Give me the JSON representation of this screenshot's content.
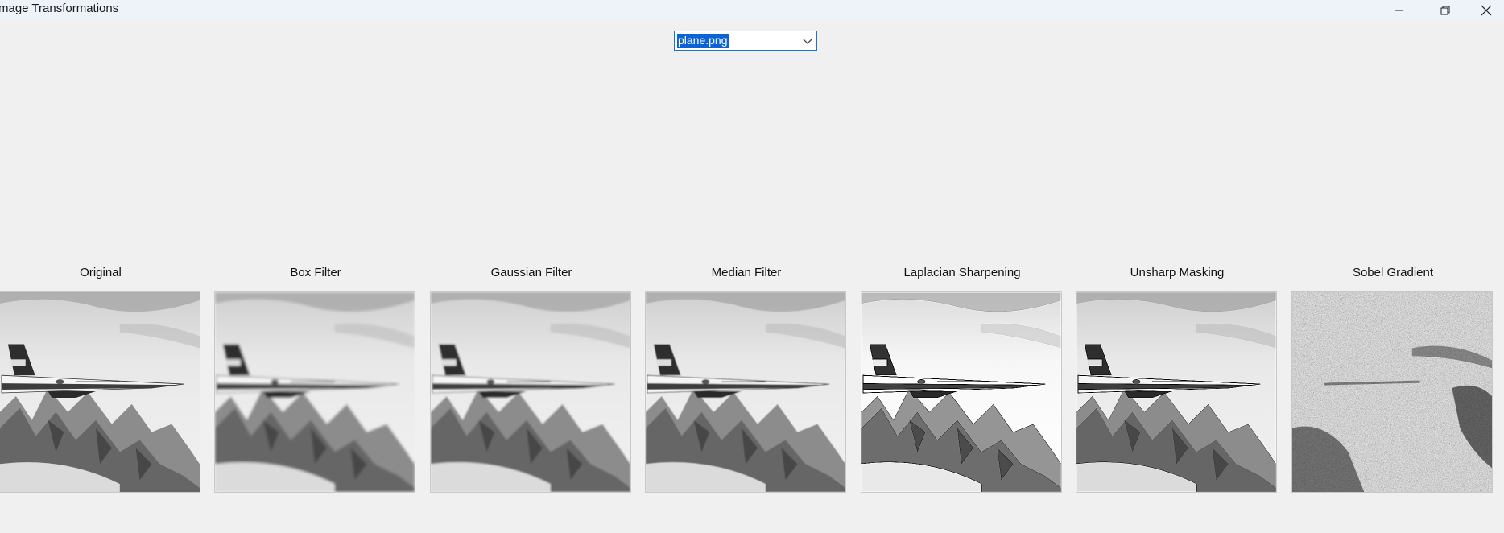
{
  "window": {
    "title": "mage Transformations",
    "controls": {
      "minimize": "minimize-icon",
      "maximize": "restore-icon",
      "close": "close-icon"
    }
  },
  "file_select": {
    "selected": "plane.png",
    "selected_highlight": "#0b63d6",
    "border_color": "#1f6fcc"
  },
  "panels": [
    {
      "label": "Original",
      "image": "grayscale photo of F-16 jet over snowy mountains"
    },
    {
      "label": "Box Filter",
      "image": "blurred grayscale jet photo"
    },
    {
      "label": "Gaussian Filter",
      "image": "smoothed grayscale jet photo"
    },
    {
      "label": "Median Filter",
      "image": "median filtered grayscale jet photo"
    },
    {
      "label": "Laplacian Sharpening",
      "image": "sharpened grayscale jet photo"
    },
    {
      "label": "Unsharp Masking",
      "image": "unsharp masked grayscale jet photo"
    },
    {
      "label": "Sobel Gradient",
      "image": "noisy gradient magnitude image"
    }
  ],
  "colors": {
    "background": "#f0f0f0",
    "titlebar": "#eef2f9"
  }
}
